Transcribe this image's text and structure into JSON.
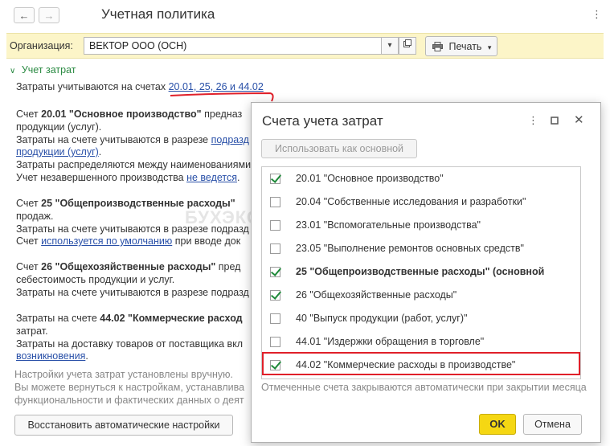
{
  "window": {
    "title": "Учетная политика",
    "back_icon": "←",
    "forward_icon": "→",
    "more_icon": "⋮"
  },
  "org": {
    "label": "Организация:",
    "value": "ВЕКТОР ООО (ОСН)",
    "print_label": "Печать"
  },
  "section": {
    "title": "Учет затрат",
    "line1_text": "Затраты учитываются на счетах ",
    "line1_link": "20.01, 25, 26 и 44.02",
    "b1_acc": "Счет ",
    "b1_bold": "20.01 \"Основное производство\"",
    "b1_rest": " предназ",
    "b1_l2": "продукции (услуг).",
    "b1_l3_text": "Затраты на счете учитываются в разрезе ",
    "b1_l3_link": "подразд",
    "b1_l4_link": "продукции (услуг)",
    "b1_l4_tail": ".",
    "b1_l5": "Затраты распределяются между наименованиями",
    "b1_l6_text": "Учет незавершенного производства ",
    "b1_l6_link": "не ведется",
    "b1_l6_tail": ".",
    "b2_acc": "Счет ",
    "b2_bold": "25 \"Общепроизводственные расходы\"",
    "b2_l2": "продаж.",
    "b2_l3": "Затраты на счете учитываются в разрезе подразд",
    "b2_l4_text": "Счет ",
    "b2_l4_link": "используется по умолчанию",
    "b2_l4_tail": " при вводе док",
    "b3_acc": "Счет ",
    "b3_bold": "26 \"Общехозяйственные расходы\"",
    "b3_rest": " пред",
    "b3_l2": "себестоимость продукции и услуг.",
    "b3_l3": "Затраты на счете учитываются в разрезе подразд",
    "b4_text": "Затраты на счете ",
    "b4_bold": "44.02 \"Коммерческие расход",
    "b4_l2": "затрат.",
    "b4_l3": "Затраты на доставку товаров от поставщика вкл",
    "b4_l4_link": "возникновения",
    "b4_l4_tail": ".",
    "info1": "Настройки учета затрат установлены вручную.",
    "info2": "Вы можете вернуться к настройкам, устанавлива",
    "info3": "функциональности и фактических данных о деят",
    "restore_label": "Восстановить автоматические настройки"
  },
  "dialog": {
    "title": "Счета учета затрат",
    "use_as_main_label": "Использовать как основной",
    "accounts": [
      {
        "label": "20.01 \"Основное производство\"",
        "checked": true,
        "bold": false
      },
      {
        "label": "20.04 \"Собственные исследования и разработки\"",
        "checked": false,
        "bold": false
      },
      {
        "label": "23.01 \"Вспомогательные производства\"",
        "checked": false,
        "bold": false
      },
      {
        "label": "23.05 \"Выполнение ремонтов основных средств\"",
        "checked": false,
        "bold": false
      },
      {
        "label": "25 \"Общепроизводственные расходы\" (основной",
        "checked": true,
        "bold": true
      },
      {
        "label": "26 \"Общехозяйственные расходы\"",
        "checked": true,
        "bold": false
      },
      {
        "label": "40 \"Выпуск продукции (работ, услуг)\"",
        "checked": false,
        "bold": false
      },
      {
        "label": "44.01 \"Издержки обращения в торговле\"",
        "checked": false,
        "bold": false
      },
      {
        "label": "44.02 \"Коммерческие расходы в производстве\"",
        "checked": true,
        "bold": false
      }
    ],
    "note": "Отмеченные счета закрываются автоматически при закрытии месяца",
    "ok_label": "OK",
    "cancel_label": "Отмена"
  },
  "watermark": "БУХЭКСПЕРТ",
  "colors": {
    "accent_green": "#2a8a42",
    "link_blue": "#2950a8",
    "org_bar_bg": "#fcf5c8",
    "ok_yellow": "#f5d713",
    "highlight_red": "#e0202a"
  }
}
